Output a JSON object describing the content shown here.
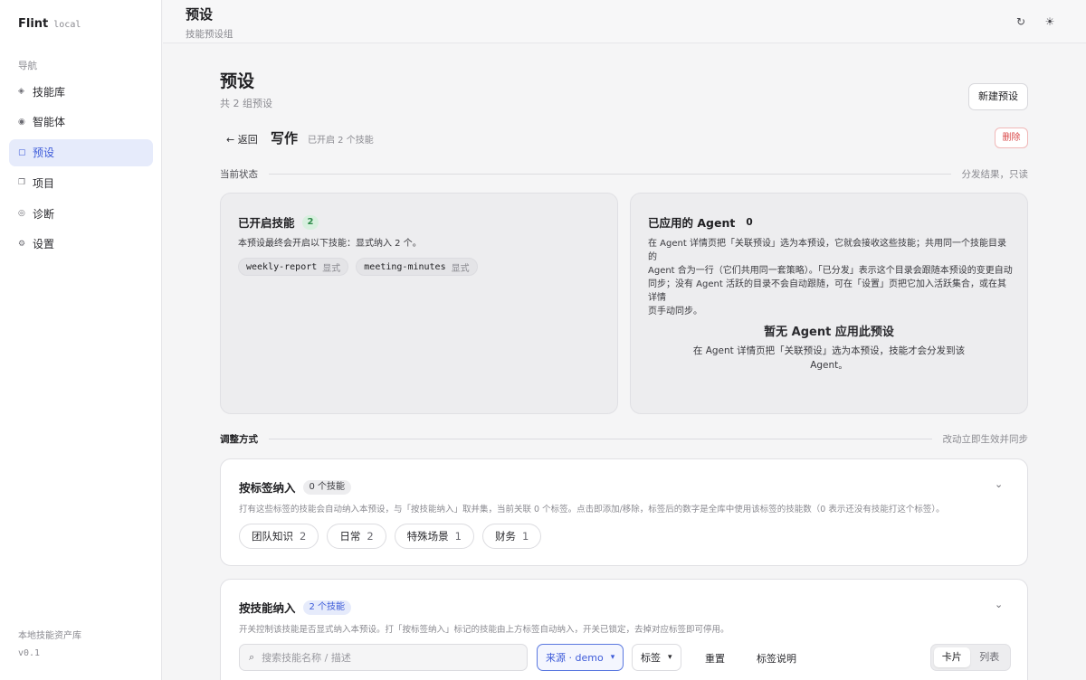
{
  "app": {
    "name": "Flint",
    "tag": "local"
  },
  "sidebar": {
    "heading": "导航",
    "items": [
      {
        "label": "技能库",
        "icon": "◈"
      },
      {
        "label": "智能体",
        "icon": "◉"
      },
      {
        "label": "预设",
        "icon": "▢"
      },
      {
        "label": "项目",
        "icon": "❐"
      },
      {
        "label": "诊断",
        "icon": "◎"
      },
      {
        "label": "设置",
        "icon": "⚙"
      }
    ],
    "footer_label": "本地技能资产库",
    "footer_version": "v0.1"
  },
  "topbar": {
    "title": "预设",
    "subtitle": "技能预设组",
    "refresh_icon": "↻",
    "theme_icon": "☀"
  },
  "page": {
    "title": "预设",
    "count": "共 2 组预设",
    "new_button": "新建预设",
    "back": "← 返回",
    "preset_name": "写作",
    "preset_meta": "已开启 2 个技能",
    "delete_button": "删除"
  },
  "current_state": {
    "label": "当前状态",
    "note": "分发结果，只读"
  },
  "enabled_skills": {
    "title": "已开启技能",
    "count": "2",
    "desc": "本预设最终会开启以下技能：显式纳入 2 个。",
    "skills": [
      {
        "name": "weekly-report",
        "tag": "显式"
      },
      {
        "name": "meeting-minutes",
        "tag": "显式"
      }
    ]
  },
  "applied_agents": {
    "title": "已应用的 Agent",
    "count": "0",
    "desc_1": "在 Agent 详情页把「关联预设」选为本预设，它就会接收这些技能；共用同一个技能目录的",
    "desc_2": "Agent 合为一行（它们共用同一套策略）。「已分发」表示这个目录会跟随本预设的变更自动",
    "desc_3": "同步；没有 Agent 活跃的目录不会自动跟随，可在「设置」页把它加入活跃集合，或在其详情",
    "desc_4": "页手动同步。",
    "empty_title": "暂无 Agent 应用此预设",
    "empty_desc": "在 Agent 详情页把「关联预设」选为本预设，技能才会分发到该 Agent。"
  },
  "adjust": {
    "label": "调整方式",
    "note": "改动立即生效并同步"
  },
  "by_tag": {
    "title": "按标签纳入",
    "count": "0 个技能",
    "desc": "打有这些标签的技能会自动纳入本预设，与「按技能纳入」取并集，当前关联 0 个标签。点击即添加/移除，标签后的数字是全库中使用该标签的技能数（0 表示还没有技能打这个标签）。",
    "tags": [
      {
        "label": "团队知识",
        "num": "2"
      },
      {
        "label": "日常",
        "num": "2"
      },
      {
        "label": "特殊场景",
        "num": "1"
      },
      {
        "label": "财务",
        "num": "1"
      }
    ]
  },
  "by_skill": {
    "title": "按技能纳入",
    "count": "2 个技能",
    "desc": "开关控制该技能是否显式纳入本预设。打「按标签纳入」标记的技能由上方标签自动纳入，开关已锁定，去掉对应标签即可停用。",
    "search_placeholder": "搜索技能名称 / 描述",
    "source_select": "来源 · demo",
    "tag_select": "标签",
    "reset": "重置",
    "tag_help": "标签说明",
    "view_card": "卡片",
    "view_list": "列表"
  },
  "colors": {
    "accent": "#3d5bd9",
    "danger": "#d94848",
    "success": "#2f8a4a"
  }
}
